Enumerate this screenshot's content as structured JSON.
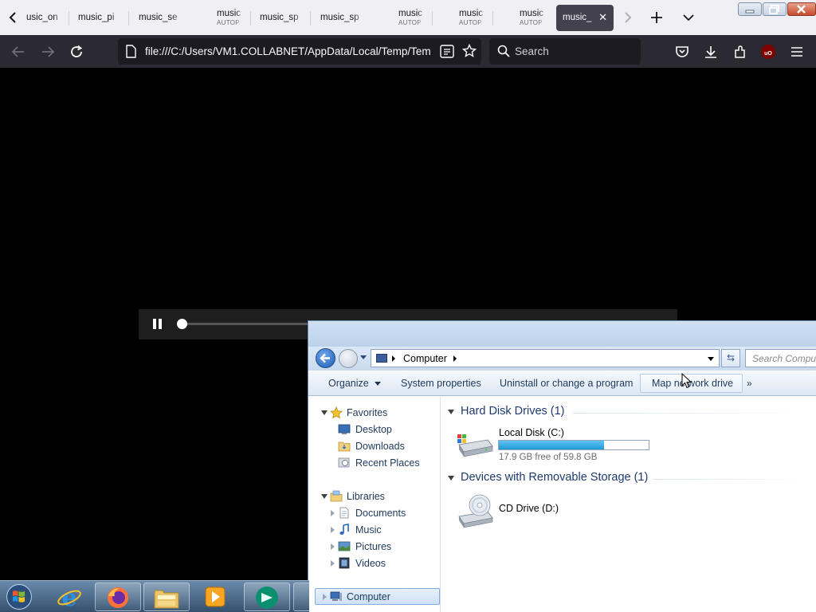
{
  "browser": {
    "tabs": [
      {
        "title": "usic_on",
        "subtitle": ""
      },
      {
        "title": "music_pi",
        "subtitle": ""
      },
      {
        "title": "music_se",
        "subtitle": ""
      },
      {
        "title": "music",
        "subtitle": "AUTOP"
      },
      {
        "title": "music_sp",
        "subtitle": ""
      },
      {
        "title": "music_sp",
        "subtitle": ""
      },
      {
        "title": "music",
        "subtitle": "AUTOP"
      },
      {
        "title": "music",
        "subtitle": "AUTOP"
      },
      {
        "title": "music",
        "subtitle": "AUTOP"
      },
      {
        "title": "music_",
        "subtitle": ""
      }
    ],
    "url": "file:///C:/Users/VM1.COLLABNET/AppData/Local/Temp/Tem",
    "search_placeholder": "Search",
    "addon_badge": "uO"
  },
  "video": {
    "progress": 0.0
  },
  "explorer": {
    "breadcrumb": "Computer",
    "search_placeholder": "Search Computer",
    "toolbar": {
      "organize": "Organize",
      "system_properties": "System properties",
      "uninstall": "Uninstall or change a program",
      "map_network_drive": "Map network drive",
      "more": "»"
    },
    "nav": {
      "favorites": "Favorites",
      "desktop": "Desktop",
      "downloads": "Downloads",
      "recent_places": "Recent Places",
      "libraries": "Libraries",
      "documents": "Documents",
      "music": "Music",
      "pictures": "Pictures",
      "videos": "Videos",
      "computer": "Computer"
    },
    "groups": {
      "hard_disks": "Hard Disk Drives (1)",
      "removable": "Devices with Removable Storage (1)"
    },
    "drives": {
      "c_name": "Local Disk (C:)",
      "c_free": "17.9 GB free of 59.8 GB",
      "c_used_fraction": 0.7,
      "d_name": "CD Drive (D:)"
    }
  },
  "taskbar": {
    "items": [
      "start-orb",
      "internet-explorer",
      "firefox",
      "windows-explorer",
      "media-player",
      "app"
    ]
  }
}
